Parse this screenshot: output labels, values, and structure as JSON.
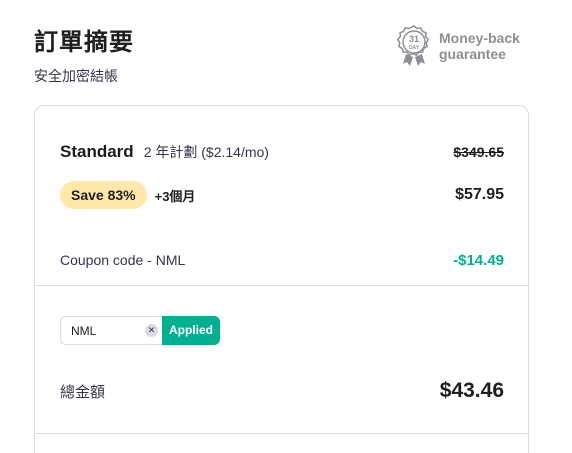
{
  "header": {
    "title": "訂單摘要",
    "subtitle": "安全加密結帳"
  },
  "guarantee": {
    "badge_number": "31",
    "badge_unit": "DAY",
    "line1": "Money-back",
    "line2": "guarantee",
    "icon": "ribbon-badge-icon"
  },
  "plan": {
    "name": "Standard",
    "period": "2 年計劃 ($2.14/mo)",
    "original_price": "$349.65",
    "save_badge": "Save 83%",
    "extra_months": "+3個月",
    "price": "$57.95"
  },
  "coupon": {
    "label": "Coupon code - NML",
    "discount": "-$14.49",
    "input_value": "NML",
    "clear_icon": "close-icon",
    "applied_label": "Applied"
  },
  "total": {
    "label": "總金額",
    "value": "$43.46"
  },
  "colors": {
    "accent_green": "#00b090",
    "save_badge_bg": "#ffe8a8",
    "muted_text": "#8c8f96",
    "border": "#dadce0"
  }
}
